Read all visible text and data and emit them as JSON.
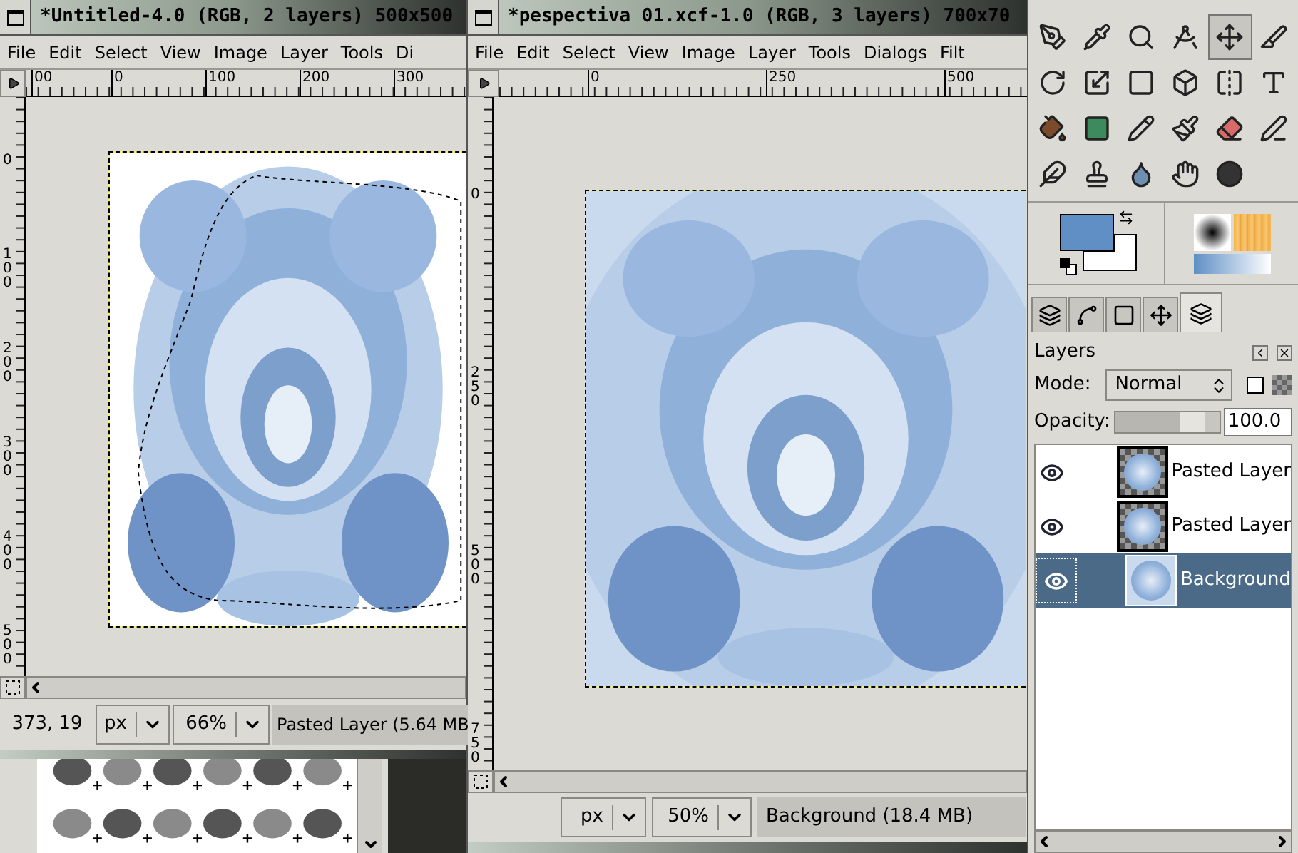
{
  "windows": [
    {
      "title": "*Untitled-4.0 (RGB, 2 layers) 500x500",
      "menu": [
        "File",
        "Edit",
        "Select",
        "View",
        "Image",
        "Layer",
        "Tools",
        "Di"
      ],
      "hruler": [
        "00",
        "0",
        "100",
        "200",
        "300"
      ],
      "vruler": [
        "0",
        "100",
        "200",
        "300",
        "400",
        "500"
      ],
      "status": {
        "coords": "373, 19",
        "unit": "px",
        "zoom": "66%",
        "info": "Pasted Layer (5.64 MB"
      },
      "selection": true
    },
    {
      "title": "*pespectiva 01.xcf-1.0 (RGB, 3 layers) 700x70",
      "menu": [
        "File",
        "Edit",
        "Select",
        "View",
        "Image",
        "Layer",
        "Tools",
        "Dialogs",
        "Filt"
      ],
      "hruler": [
        "0",
        "250",
        "500"
      ],
      "vruler": [
        "0",
        "250",
        "500",
        "750"
      ],
      "status": {
        "unit": "px",
        "zoom": "50%",
        "info": "Background (18.4 MB)"
      },
      "selection": false
    }
  ],
  "toolbox": {
    "tools": [
      {
        "kind": "path",
        "selected": false
      },
      {
        "kind": "picker",
        "selected": false
      },
      {
        "kind": "zoom",
        "selected": false
      },
      {
        "kind": "measure",
        "selected": false
      },
      {
        "kind": "move",
        "selected": true
      },
      {
        "kind": "crop",
        "selected": false
      },
      {
        "kind": "rotate",
        "selected": false
      },
      {
        "kind": "scale",
        "selected": false
      },
      {
        "kind": "shear",
        "selected": false
      },
      {
        "kind": "perspective",
        "selected": false
      },
      {
        "kind": "flip",
        "selected": false
      },
      {
        "kind": "text",
        "selected": false
      },
      {
        "kind": "bucket",
        "selected": false
      },
      {
        "kind": "gradient",
        "selected": false
      },
      {
        "kind": "pencil",
        "selected": false
      },
      {
        "kind": "brush",
        "selected": false
      },
      {
        "kind": "eraser",
        "selected": false
      },
      {
        "kind": "airbrush",
        "selected": false
      },
      {
        "kind": "ink",
        "selected": false
      },
      {
        "kind": "clone",
        "selected": false
      },
      {
        "kind": "blur",
        "selected": false
      },
      {
        "kind": "smudge",
        "selected": false
      },
      {
        "kind": "dodge",
        "selected": false
      }
    ],
    "foreground": {
      "color": "#5f8fc4"
    },
    "background": {
      "color": "#ffffff"
    }
  },
  "dock": {
    "tabs": [
      {
        "kind": "channels",
        "selected": false
      },
      {
        "kind": "paths",
        "selected": false
      },
      {
        "kind": "colormap",
        "selected": false
      },
      {
        "kind": "move",
        "selected": false
      },
      {
        "kind": "layers",
        "selected": true
      }
    ],
    "title": "Layers",
    "mode_label": "Mode:",
    "mode": "Normal",
    "lock_alpha": {
      "checked": false
    },
    "opacity_label": "Opacity:",
    "opacity": {
      "level": 0.86,
      "value": "100.0"
    },
    "layers": [
      {
        "name": "Pasted Layer",
        "visible": true,
        "has_alpha": true,
        "selected": false
      },
      {
        "name": "Pasted Layer",
        "visible": true,
        "has_alpha": true,
        "selected": false
      },
      {
        "name": "Background",
        "visible": true,
        "has_alpha": false,
        "selected": true
      }
    ]
  }
}
